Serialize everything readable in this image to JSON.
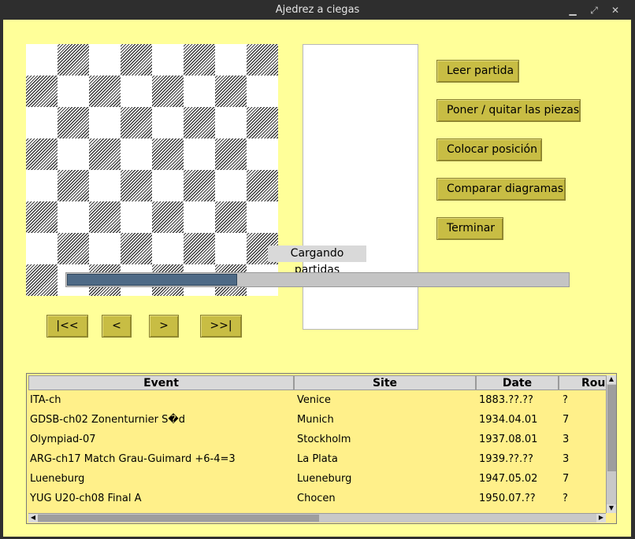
{
  "window": {
    "title": "Ajedrez a ciegas"
  },
  "buttons": {
    "read_game": "Leer partida",
    "toggle_pieces": "Poner / quitar las piezas",
    "set_position": "Colocar posición",
    "compare_diagrams": "Comparar diagramas",
    "finish": "Terminar"
  },
  "nav": {
    "first": "|<<",
    "prev": "<",
    "next": ">",
    "last": ">>|"
  },
  "loading": {
    "label": "Cargando partidas",
    "progress": 0.34
  },
  "games_table": {
    "columns": [
      "Event",
      "Site",
      "Date",
      "Round"
    ],
    "rows": [
      [
        "ITA-ch",
        "Venice",
        "1883.??.??",
        "?"
      ],
      [
        "GDSB-ch02 Zonenturnier S�d",
        "Munich",
        "1934.04.01",
        "7"
      ],
      [
        "Olympiad-07",
        "Stockholm",
        "1937.08.01",
        "3"
      ],
      [
        "ARG-ch17 Match Grau-Guimard +6-4=3",
        "La Plata",
        "1939.??.??",
        "3"
      ],
      [
        "Lueneburg",
        "Lueneburg",
        "1947.05.02",
        "7"
      ],
      [
        "YUG U20-ch08 Final A",
        "Chocen",
        "1950.07.??",
        "?"
      ]
    ]
  },
  "colors": {
    "background": "#ffff99",
    "button": "#c8bd44",
    "progress_fill": "#4e6a86",
    "table_rows": "#fff08a"
  }
}
